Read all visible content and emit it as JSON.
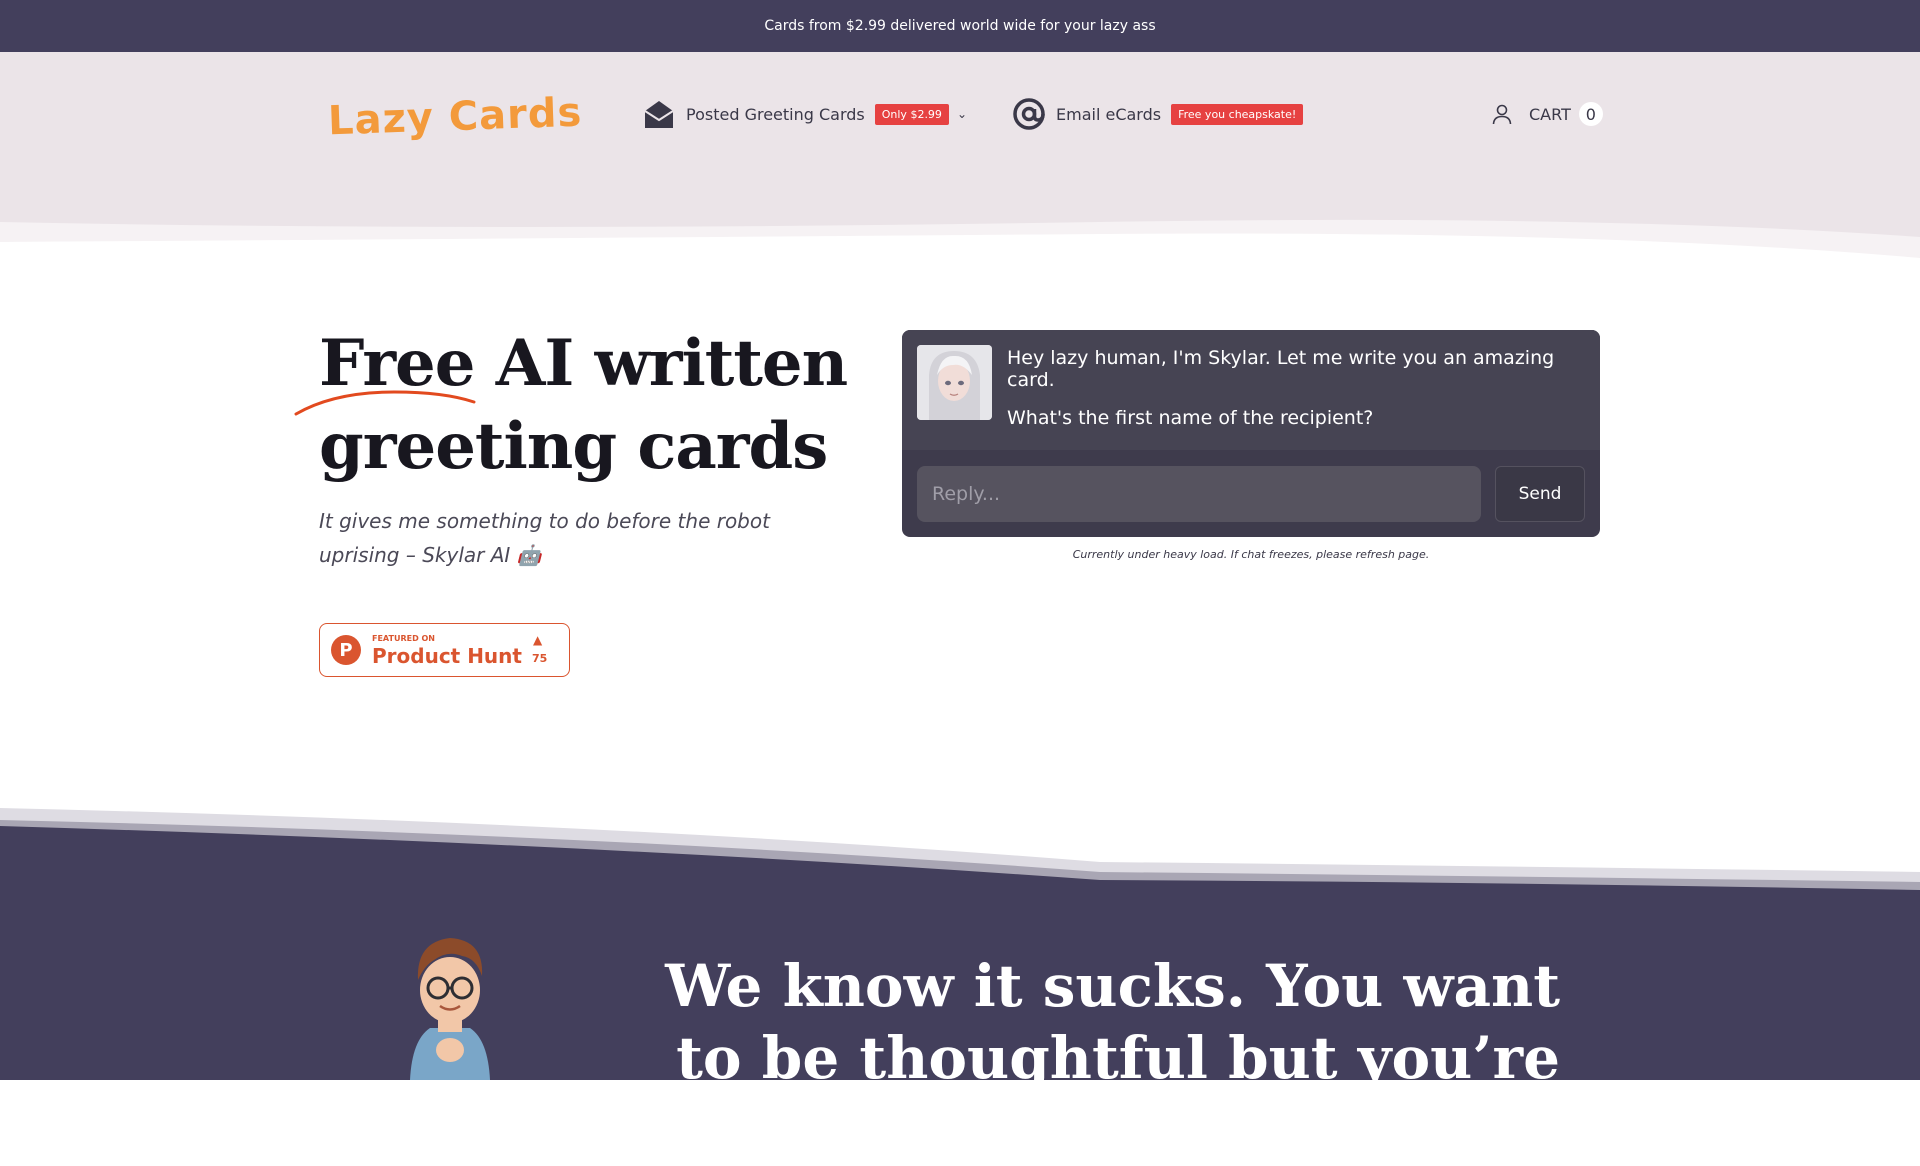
{
  "announcement": {
    "text": "Cards from $2.99 delivered world wide for your lazy ass"
  },
  "header": {
    "logo": "Lazy Cards",
    "nav": [
      {
        "label": "Posted Greeting Cards",
        "badge": "Only $2.99",
        "icon": "envelope-icon",
        "has_dropdown": true
      },
      {
        "label": "Email eCards",
        "badge": "Free you cheapskate!",
        "icon": "at-icon",
        "has_dropdown": false
      }
    ],
    "cart_label": "CART",
    "cart_count": "0"
  },
  "hero": {
    "title_line1": "Free AI written",
    "title_line2": "greeting cards",
    "subtitle": "It gives me something to do before the robot uprising – Skylar AI 🤖"
  },
  "product_hunt": {
    "featured": "FEATURED ON",
    "name": "Product Hunt",
    "count": "75"
  },
  "chat": {
    "message1": "Hey lazy human, I'm Skylar. Let me write you an amazing card.",
    "message2": "What's the first name of the recipient?",
    "placeholder": "Reply...",
    "send_label": "Send",
    "note": "Currently under heavy load. If chat freezes, please refresh page."
  },
  "lower": {
    "title": "We know it sucks. You want to be thoughtful but you’re lazy."
  },
  "colors": {
    "dark": "#433f5c",
    "header_bg": "#ebe4e8",
    "logo": "#f39a3b",
    "badge": "#e64141",
    "product_hunt": "#da552f",
    "underline": "#e24a1f"
  }
}
